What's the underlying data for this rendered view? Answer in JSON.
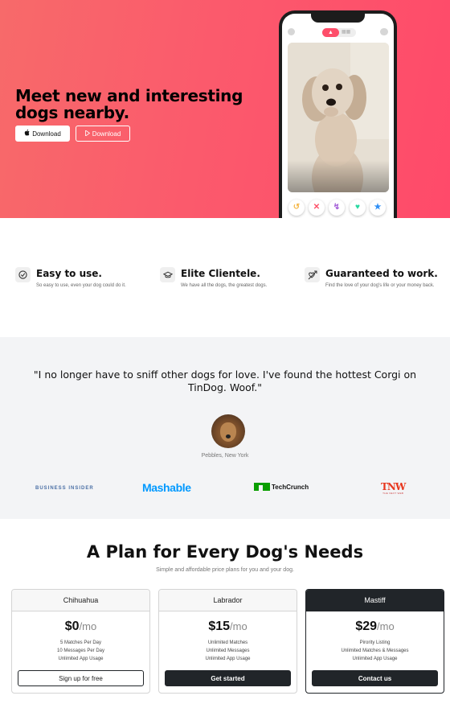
{
  "colors": {
    "hero_gradient_start": "#f76a6a",
    "hero_gradient_end": "#ff4a6a",
    "tinder_pink": "#fe4e6a",
    "dark": "#212529"
  },
  "hero": {
    "headline": "Meet new and interesting dogs nearby.",
    "download_apple_label": "Download",
    "download_apple_icon": "apple-icon",
    "download_play_label": "Download",
    "download_play_icon": "play-store-icon"
  },
  "phone": {
    "toggle_icon": "flame-icon",
    "action_icons": [
      "rewind-icon",
      "close-icon",
      "lightning-icon",
      "heart-icon",
      "star-icon"
    ]
  },
  "features": [
    {
      "icon": "check-circle-icon",
      "title": "Easy to use.",
      "desc": "So easy to use, even your dog could do it."
    },
    {
      "icon": "graduation-cap-icon",
      "title": "Elite Clientele.",
      "desc": "We have all the dogs, the greatest dogs."
    },
    {
      "icon": "heart-arrow-icon",
      "title": "Guaranteed to work.",
      "desc": "Find the love of your dog's life or your money back."
    }
  ],
  "testimonial": {
    "quote": "\"I no longer have to sniff other dogs for love. I've found the hottest Corgi on TinDog. Woof.\"",
    "author": "Pebbles, New York"
  },
  "press": {
    "business_insider": "BUSINESS INSIDER",
    "mashable": "Mashable",
    "techcrunch": "TechCrunch",
    "tnw": "TNW",
    "tnw_sub": "THE NEXT WEB"
  },
  "pricing": {
    "title": "A Plan for Every Dog's Needs",
    "subtitle": "Simple and affordable price plans for you and your dog.",
    "plans": [
      {
        "name": "Chihuahua",
        "price": "$0",
        "per": "/mo",
        "features": [
          "5 Matches Per Day",
          "10 Messages Per Day",
          "Unlimited App Usage"
        ],
        "button": "Sign up for free"
      },
      {
        "name": "Labrador",
        "price": "$15",
        "per": "/mo",
        "features": [
          "Unlimited Matches",
          "Unlimited Messages",
          "Unlimited App Usage"
        ],
        "button": "Get started"
      },
      {
        "name": "Mastiff",
        "price": "$29",
        "per": "/mo",
        "features": [
          "Pirority Listing",
          "Unlimited Matches & Messages",
          "Unlimited App Usage"
        ],
        "button": "Contact us"
      }
    ]
  }
}
